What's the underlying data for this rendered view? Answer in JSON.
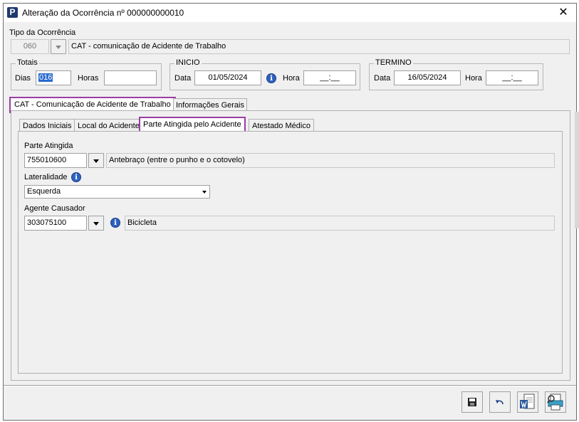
{
  "window": {
    "title": "Alteração da Ocorrência nº 000000000010",
    "close_label": "✕"
  },
  "tipo": {
    "label": "Tipo da Ocorrência",
    "code": "060",
    "description": "CAT - comunicação de Acidente de Trabalho"
  },
  "totais": {
    "legend": "Totais",
    "dias_label": "Dias",
    "dias_value": "016",
    "horas_label": "Horas",
    "horas_value": ""
  },
  "inicio": {
    "legend": "INICIO",
    "data_label": "Data",
    "data_value": "01/05/2024",
    "hora_label": "Hora",
    "hora_value": "__:__"
  },
  "termino": {
    "legend": "TERMINO",
    "data_label": "Data",
    "data_value": "16/05/2024",
    "hora_label": "Hora",
    "hora_value": "__:__"
  },
  "main_tabs": [
    "CAT - Comunicação de Acidente de Trabalho",
    "Informações Gerais"
  ],
  "sub_tabs": [
    "Dados Iniciais",
    "Local do Acidente",
    "Parte Atingida pelo Acidente",
    "Atestado Médico"
  ],
  "parte": {
    "label": "Parte Atingida",
    "code": "755010600",
    "description": "Antebraço (entre o punho e o cotovelo)"
  },
  "lateralidade": {
    "label": "Lateralidade",
    "value": "Esquerda"
  },
  "agente": {
    "label": "Agente Causador",
    "code": "303075100",
    "description": "Bicicleta"
  },
  "icons": {
    "info": "i",
    "app": "P"
  },
  "toolbar": [
    "save-icon",
    "undo-icon",
    "word-document-icon",
    "print-preview-icon"
  ],
  "colors": {
    "highlight": "#9b3ea3",
    "info_blue": "#2e62c0"
  }
}
